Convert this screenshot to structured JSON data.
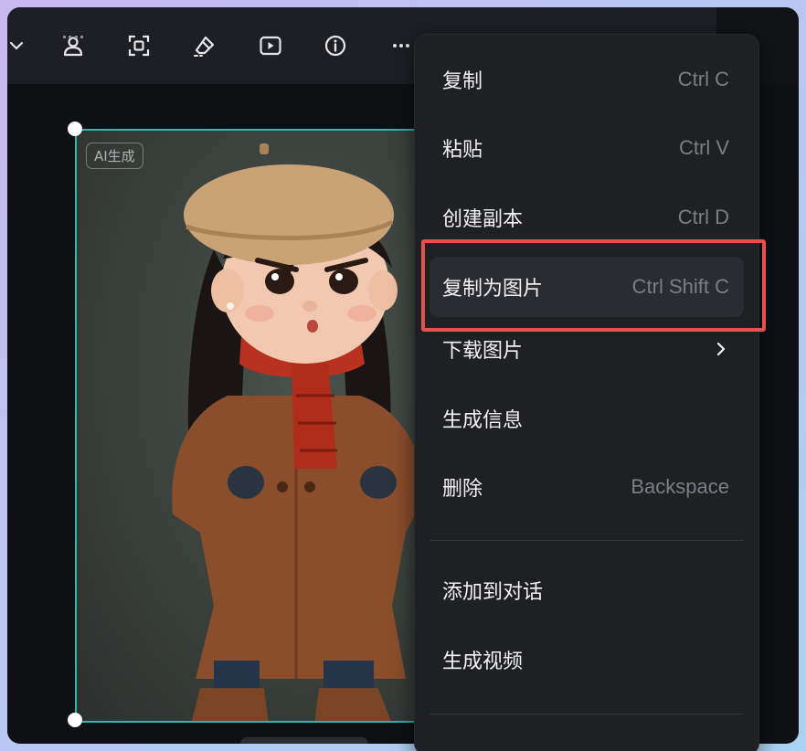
{
  "image": {
    "badge": "AI生成"
  },
  "toolbar": {
    "icons": [
      "chevron-down-icon",
      "person-cutout-icon",
      "focus-frame-icon",
      "eraser-icon",
      "play-icon",
      "info-icon",
      "more-icon"
    ]
  },
  "menu": {
    "items": [
      {
        "label": "复制",
        "shortcut": "Ctrl C"
      },
      {
        "label": "粘贴",
        "shortcut": "Ctrl V"
      },
      {
        "label": "创建副本",
        "shortcut": "Ctrl D"
      },
      {
        "label": "复制为图片",
        "shortcut": "Ctrl Shift C"
      },
      {
        "label": "下载图片",
        "shortcut": ""
      },
      {
        "label": "生成信息",
        "shortcut": ""
      },
      {
        "label": "删除",
        "shortcut": "Backspace"
      },
      {
        "label": "添加到对话",
        "shortcut": ""
      },
      {
        "label": "生成视频",
        "shortcut": ""
      }
    ],
    "highlighted_index": 3,
    "highlight_color": "#e9504b"
  },
  "colors": {
    "selection": "#2fb8b0",
    "menu_bg": "#1f2024",
    "canvas_bg": "#0f1014"
  }
}
